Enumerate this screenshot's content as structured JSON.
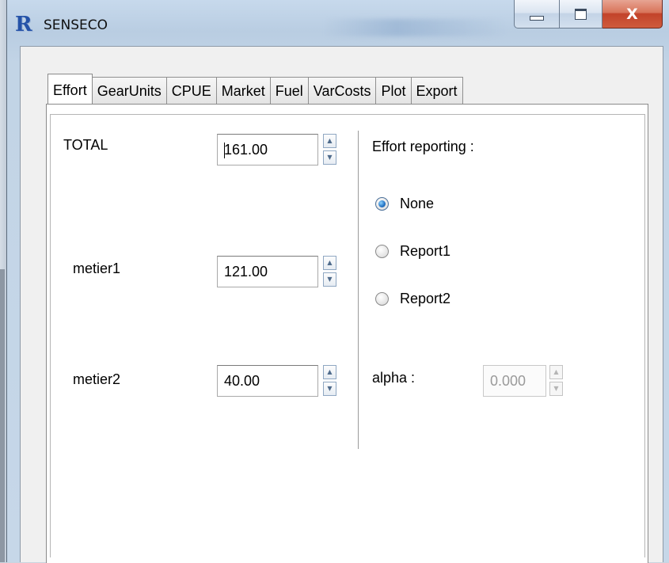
{
  "window": {
    "title": "SENSECO",
    "icon": "r-logo-icon",
    "controls": {
      "minimize": "minimize-icon",
      "maximize": "maximize-icon",
      "close": "X"
    }
  },
  "tabs": [
    {
      "label": "Effort",
      "active": true
    },
    {
      "label": "GearUnits",
      "active": false
    },
    {
      "label": "CPUE",
      "active": false
    },
    {
      "label": "Market",
      "active": false
    },
    {
      "label": "Fuel",
      "active": false
    },
    {
      "label": "VarCosts",
      "active": false
    },
    {
      "label": "Plot",
      "active": false
    },
    {
      "label": "Export",
      "active": false
    }
  ],
  "effort": {
    "total": {
      "label": "TOTAL",
      "value": "161.00"
    },
    "metier1": {
      "label": "metier1",
      "value": "121.00"
    },
    "metier2": {
      "label": "metier2",
      "value": "40.00"
    }
  },
  "reporting": {
    "heading": "Effort reporting :",
    "options": [
      {
        "label": "None",
        "selected": true
      },
      {
        "label": "Report1",
        "selected": false
      },
      {
        "label": "Report2",
        "selected": false
      }
    ],
    "alpha": {
      "label": "alpha :",
      "value": "0.000",
      "enabled": false
    }
  },
  "colors": {
    "accent": "#2a79c8",
    "close_button": "#c2432a",
    "window_frame": "#c6d7e8"
  }
}
